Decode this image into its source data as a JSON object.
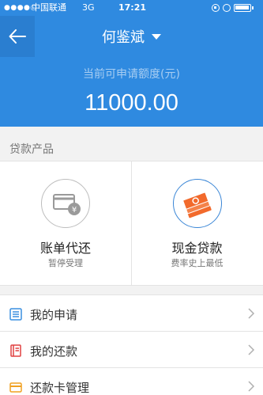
{
  "status_bar": {
    "signal": "●●●●○",
    "carrier": "中国联通",
    "network": "3G",
    "time": "17:21"
  },
  "nav": {
    "title": "何鉴斌"
  },
  "quota": {
    "label": "当前可申请额度(元)",
    "amount": "11000.00"
  },
  "products_section": {
    "title": "贷款产品",
    "items": [
      {
        "name": "账单代还",
        "subtitle": "暂停受理",
        "icon": "credit-card-yen-icon"
      },
      {
        "name": "现金贷款",
        "subtitle": "费率史上最低",
        "icon": "cash-stack-icon"
      }
    ]
  },
  "menu": {
    "items": [
      {
        "label": "我的申请",
        "icon": "application-list-icon",
        "color": "#3a8fe0"
      },
      {
        "label": "我的还款",
        "icon": "repayment-book-icon",
        "color": "#e04040"
      },
      {
        "label": "还款卡管理",
        "icon": "card-manage-icon",
        "color": "#f0a020"
      }
    ]
  },
  "colors": {
    "header_blue": "#2f8ae0",
    "cash_orange": "#f26a2c",
    "accent_ring": "#3a86d6"
  }
}
